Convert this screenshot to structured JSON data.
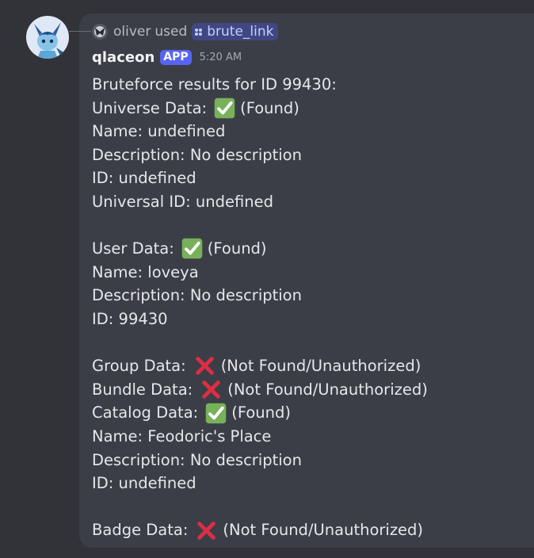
{
  "reply": {
    "user": "oliver",
    "used": "used",
    "command": "brute_link"
  },
  "author": {
    "name": "qlaceon",
    "badge": "APP",
    "time": "5:20 AM"
  },
  "icons": {
    "found": "white-heavy-check-mark-icon",
    "not_found": "cross-mark-icon",
    "command": "slash-command-icon"
  },
  "colors": {
    "background": "#313338",
    "message_panel": "#3c3e47",
    "mention_bg": "#414782",
    "badge_bg": "#5865f2",
    "check_green": "#78b159",
    "cross_red": "#dd2e44"
  },
  "message": {
    "header": "Bruteforce results for ID 99430:",
    "universe": {
      "label": "Universe Data:",
      "status": "(Found)",
      "name": "Name: undefined",
      "description": "Description: No description",
      "id": "ID: undefined",
      "universal_id": "Universal ID: undefined"
    },
    "user": {
      "label": "User Data:",
      "status": "(Found)",
      "name": "Name: loveya",
      "description": "Description: No description",
      "id": "ID: 99430"
    },
    "group": {
      "label": "Group Data:",
      "status": "(Not Found/Unauthorized)"
    },
    "bundle": {
      "label": "Bundle Data:",
      "status": "(Not Found/Unauthorized)"
    },
    "catalog": {
      "label": "Catalog Data:",
      "status": "(Found)",
      "name": "Name: Feodoric's Place",
      "description": "Description: No description",
      "id": "ID: undefined"
    },
    "badge": {
      "label": "Badge Data:",
      "status": "(Not Found/Unauthorized)"
    }
  }
}
